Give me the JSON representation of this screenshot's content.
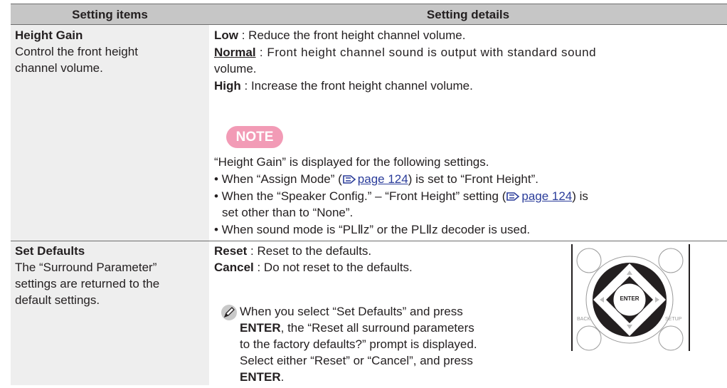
{
  "header": {
    "col1": "Setting items",
    "col2": "Setting details"
  },
  "row1": {
    "title": "Height Gain",
    "desc_line1": "Control the front height",
    "desc_line2": "channel volume.",
    "low_label": "Low",
    "low_text": " : Reduce the front height channel volume.",
    "normal_label": "Normal",
    "normal_text_line1": " : Front height channel sound is output with standard sound",
    "normal_text_line2": "volume.",
    "high_label": "High",
    "high_text": " : Increase the front height channel volume.",
    "note_label": "NOTE",
    "note_intro": "“Height Gain” is displayed for the following settings.",
    "bullet1_pre": "• When “Assign Mode” (",
    "bullet1_link": "page 124",
    "bullet1_post": ") is set to “Front Height”.",
    "bullet2_pre": "• When the “Speaker Config.” – “Front Height” setting (",
    "bullet2_link": "page 124",
    "bullet2_post": ") is",
    "bullet2_line2": "set other than to “None”.",
    "bullet3": "• When sound mode is “PLⅡz” or the PLⅡz decoder is used."
  },
  "row2": {
    "title": "Set Defaults",
    "desc_line1": "The “Surround Parameter”",
    "desc_line2": "settings are returned to the",
    "desc_line3": "default settings.",
    "reset_label": "Reset",
    "reset_text": " : Reset to the defaults.",
    "cancel_label": "Cancel",
    "cancel_text": " : Do not reset to the defaults.",
    "tip_line1": "When you select “Set Defaults” and press",
    "tip_line2_bold": "ENTER",
    "tip_line2_rest": ", the “Reset all surround parameters",
    "tip_line3": "to the factory defaults?” prompt is displayed.",
    "tip_line4": "Select either “Reset” or “Cancel”, and press",
    "tip_line5_bold": "ENTER",
    "tip_line5_rest": "."
  },
  "remote": {
    "enter_label": "ENTER",
    "back_label": "BACK",
    "setup_label": "SETUP"
  },
  "icons": {
    "reference": "page-reference-icon",
    "tip": "pencil-icon"
  }
}
